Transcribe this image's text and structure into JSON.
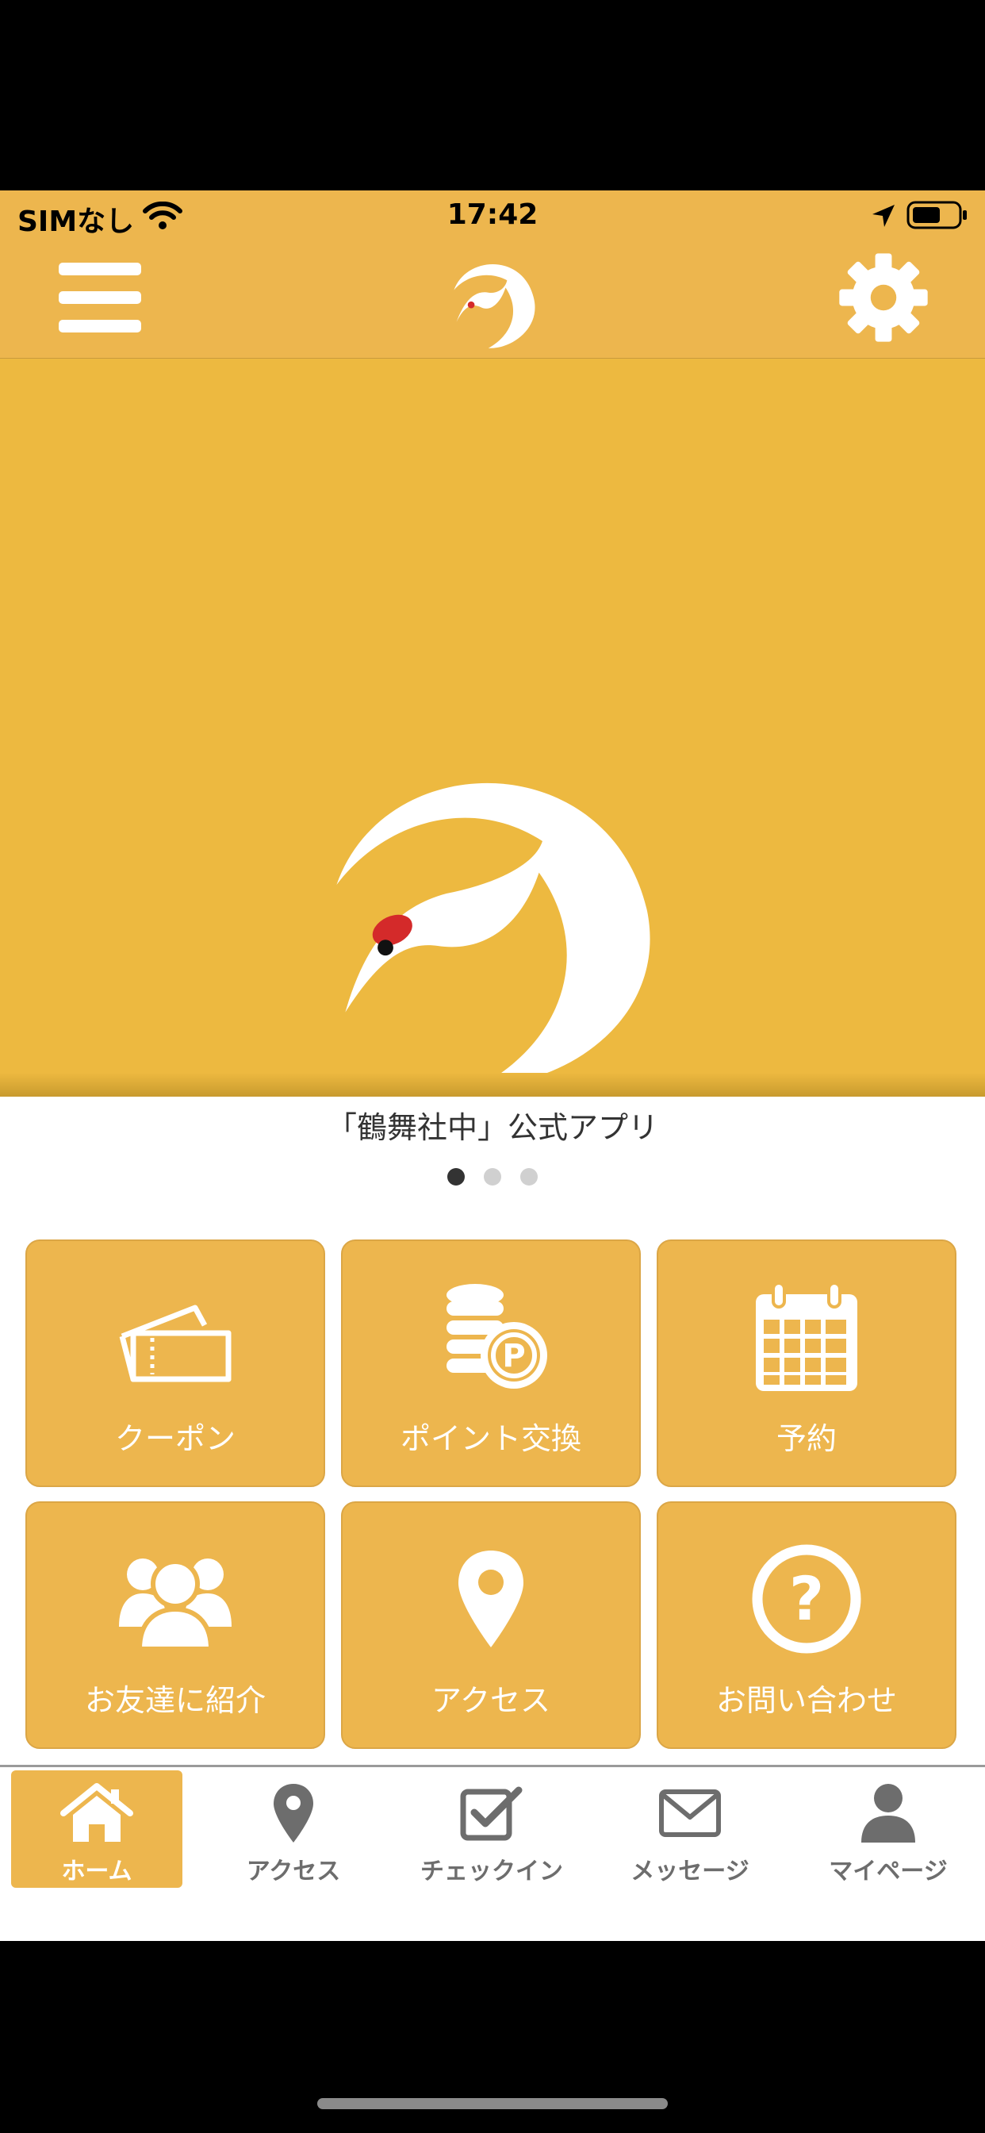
{
  "status": {
    "carrier": "SIMなし",
    "time": "17:42",
    "icons": [
      "wifi-icon",
      "location-arrow-icon",
      "battery-icon"
    ]
  },
  "header": {
    "menu_icon": "hamburger-menu-icon",
    "logo": "crane-logo",
    "settings_icon": "gear-icon"
  },
  "hero": {
    "logo": "crane-logo",
    "caption": "「鶴舞社中」公式アプリ",
    "page_index": 1,
    "page_count": 3
  },
  "menu": [
    {
      "label": "クーポン",
      "icon": "ticket-icon"
    },
    {
      "label": "ポイント交換",
      "icon": "coins-point-icon"
    },
    {
      "label": "予約",
      "icon": "calendar-icon"
    },
    {
      "label": "お友達に紹介",
      "icon": "friends-icon"
    },
    {
      "label": "アクセス",
      "icon": "map-pin-icon"
    },
    {
      "label": "お問い合わせ",
      "icon": "question-icon"
    }
  ],
  "tabs": [
    {
      "label": "ホーム",
      "icon": "home-icon",
      "active": true
    },
    {
      "label": "アクセス",
      "icon": "map-pin-icon"
    },
    {
      "label": "チェックイン",
      "icon": "checkbox-icon"
    },
    {
      "label": "メッセージ",
      "icon": "envelope-icon"
    },
    {
      "label": "マイページ",
      "icon": "user-icon"
    }
  ],
  "colors": {
    "brand": "#EDB64E",
    "hero": "#EDB940",
    "crane_red": "#D42A2A"
  }
}
